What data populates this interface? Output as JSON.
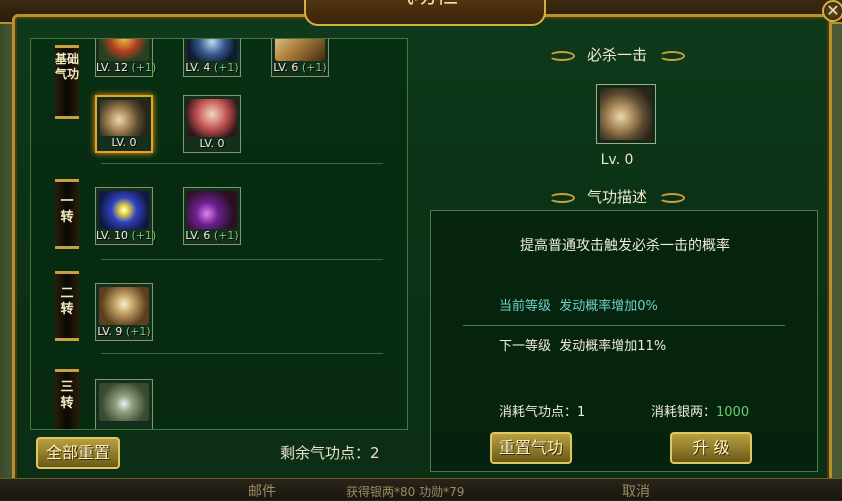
{
  "title": "气功栏",
  "close_icon": "close-icon",
  "bottom": {
    "left": "邮件",
    "mid": "获得银两*80  功勋*79",
    "right": "取消"
  },
  "tiers": [
    {
      "label": "基础气功",
      "skills": [
        {
          "lv": "LV. 12",
          "bonus": "(+1)"
        },
        {
          "lv": "LV. 4",
          "bonus": "(+1)"
        },
        {
          "lv": "LV. 6",
          "bonus": "(+1)"
        },
        {
          "lv": "LV. 0",
          "bonus": ""
        },
        {
          "lv": "LV. 0",
          "bonus": ""
        }
      ]
    },
    {
      "label": "一转",
      "skills": [
        {
          "lv": "LV. 10",
          "bonus": "(+1)"
        },
        {
          "lv": "LV. 6",
          "bonus": "(+1)"
        }
      ]
    },
    {
      "label": "二转",
      "skills": [
        {
          "lv": "LV. 9",
          "bonus": "(+1)"
        }
      ]
    },
    {
      "label": "三转",
      "skills": []
    }
  ],
  "reset_all_label": "全部重置",
  "remaining_points": "剩余气功点：2",
  "detail": {
    "skill_name": "必杀一击",
    "skill_level": "Lv. 0",
    "desc_title": "气功描述",
    "description": "提高普通攻击触发必杀一击的概率",
    "current_label": "当前等级",
    "current_effect": "发动概率增加0%",
    "next_label": "下一等级",
    "next_effect": "发动概率增加11%",
    "cost_points_label": "消耗气功点：",
    "cost_points": "1",
    "cost_silver_label": "消耗银两：",
    "cost_silver": "1000",
    "reset_button": "重置气功",
    "upgrade_button": "升 级"
  },
  "colors": {
    "accent_gold": "#d8b040",
    "current_teal": "#6ad0c8",
    "silver_green": "#6ad06a",
    "selected_orange": "#f0a020"
  }
}
